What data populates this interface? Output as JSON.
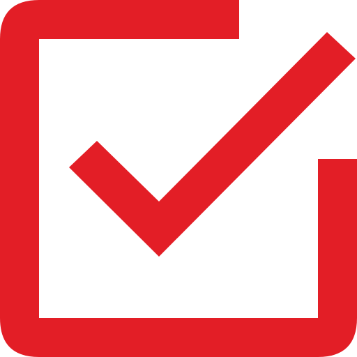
{
  "icon": {
    "name": "checked-checkbox-icon",
    "color": "#e31e26",
    "background": "#ffffff"
  }
}
